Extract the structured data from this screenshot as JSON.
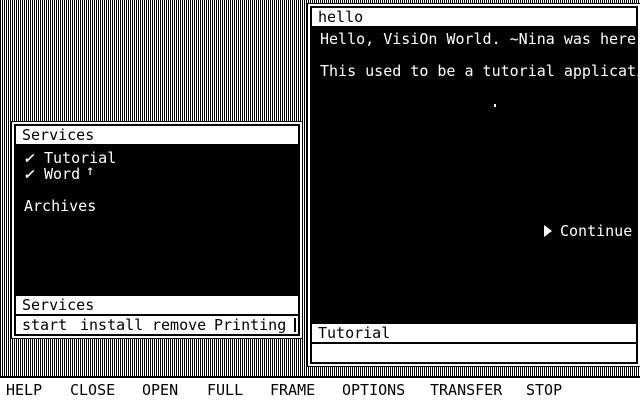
{
  "services_window": {
    "title": "Services",
    "items": [
      {
        "check": "✓",
        "label": "Tutorial"
      },
      {
        "check": "✓",
        "label": "Word"
      }
    ],
    "archives_label": "Archives",
    "status": "Services",
    "menu": [
      "start",
      "install",
      "remove",
      "Printing"
    ]
  },
  "hello_window": {
    "title": "hello",
    "line1": "Hello, VisiOn World. ~Nina was here!",
    "line2": "This used to be a tutorial application",
    "continue_label": "Continue",
    "status": "Tutorial"
  },
  "global_menu": [
    "HELP",
    "CLOSE",
    "OPEN",
    "FULL",
    "FRAME",
    "OPTIONS",
    "TRANSFER",
    "STOP"
  ],
  "icons": {
    "cursor": "mouse-pointer-icon",
    "continue": "triangle-right-icon"
  }
}
